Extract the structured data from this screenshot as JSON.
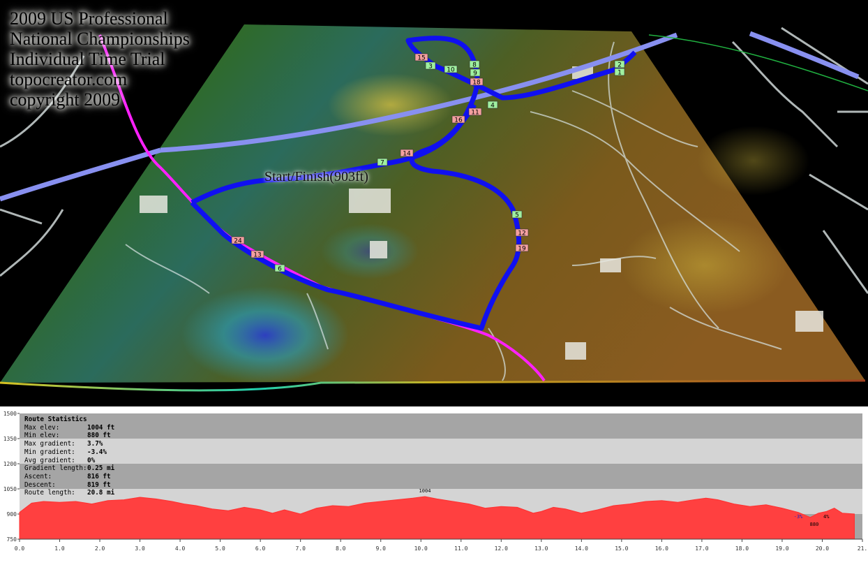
{
  "title_lines": [
    "2009 US Professional",
    "National Championships",
    "Individual Time Trial",
    "topocreator.com",
    "copyright 2009"
  ],
  "start_finish_label": "Start/Finish(903ft)",
  "route_markers": [
    {
      "label": "24",
      "color": "#f4a0a0"
    },
    {
      "label": "13",
      "color": "#f4a0a0"
    },
    {
      "label": "6",
      "color": "#a0f0a0"
    },
    {
      "label": "7",
      "color": "#a0f0a0"
    },
    {
      "label": "14",
      "color": "#f4a0a0"
    },
    {
      "label": "16",
      "color": "#f4a0a0"
    },
    {
      "label": "11",
      "color": "#f4a0a0"
    },
    {
      "label": "4",
      "color": "#a0f0a0"
    },
    {
      "label": "5",
      "color": "#a0f0a0"
    },
    {
      "label": "12",
      "color": "#f4a0a0"
    },
    {
      "label": "19",
      "color": "#f4a0a0"
    },
    {
      "label": "18",
      "color": "#f4a0a0"
    },
    {
      "label": "9",
      "color": "#a0f0a0"
    },
    {
      "label": "8",
      "color": "#a0f0a0"
    },
    {
      "label": "10",
      "color": "#a0f0a0"
    },
    {
      "label": "3",
      "color": "#a0f0a0"
    },
    {
      "label": "15",
      "color": "#f4a0a0"
    },
    {
      "label": "1",
      "color": "#a0f0a0"
    },
    {
      "label": "2",
      "color": "#a0f0a0"
    }
  ],
  "route_statistics": {
    "heading": "Route Statistics",
    "rows": [
      {
        "label": "Max elev:",
        "value": "1004 ft"
      },
      {
        "label": "Min elev:",
        "value": "880 ft"
      },
      {
        "label": "Max gradient:",
        "value": "3.7%"
      },
      {
        "label": "Min gradient:",
        "value": "-3.4%"
      },
      {
        "label": "Avg gradient:",
        "value": "0%"
      },
      {
        "label": "Gradient length:",
        "value": "0.25 mi"
      },
      {
        "label": "Ascent:",
        "value": "816 ft"
      },
      {
        "label": "Descent:",
        "value": "819 ft"
      },
      {
        "label": "Route length:",
        "value": "20.8 mi"
      }
    ]
  },
  "chart_data": {
    "type": "area",
    "xlabel": "",
    "ylabel": "",
    "xlim": [
      0,
      21
    ],
    "ylim": [
      750,
      1500
    ],
    "x_ticks": [
      "0.0",
      "1.0",
      "2.0",
      "3.0",
      "4.0",
      "5.0",
      "6.0",
      "7.0",
      "8.0",
      "9.0",
      "10.0",
      "11.0",
      "12.0",
      "13.0",
      "14.0",
      "15.0",
      "16.0",
      "17.0",
      "18.0",
      "19.0",
      "20.0",
      "21."
    ],
    "y_ticks": [
      "1500",
      "1350",
      "1200",
      "1050",
      "900",
      "750"
    ],
    "series": [
      {
        "x": [
          0,
          0.3,
          0.6,
          1.0,
          1.4,
          1.8,
          2.2,
          2.6,
          3.0,
          3.4,
          3.8,
          4.1,
          4.4,
          4.8,
          5.2,
          5.6,
          6.0,
          6.3,
          6.6,
          7.0,
          7.4,
          7.8,
          8.2,
          8.6,
          9.0,
          9.4,
          9.8,
          10.1,
          10.4,
          10.8,
          11.2,
          11.6,
          12.0,
          12.4,
          12.8,
          13.0,
          13.3,
          13.6,
          14.0,
          14.4,
          14.8,
          15.2,
          15.6,
          16.0,
          16.4,
          16.8,
          17.1,
          17.4,
          17.8,
          18.2,
          18.6,
          19.0,
          19.4,
          19.7,
          19.9,
          20.1,
          20.3,
          20.5,
          20.8
        ],
        "values": [
          910,
          965,
          975,
          970,
          975,
          960,
          980,
          985,
          1000,
          990,
          975,
          960,
          950,
          930,
          920,
          940,
          925,
          905,
          925,
          900,
          935,
          950,
          945,
          965,
          975,
          985,
          995,
          1004,
          990,
          975,
          960,
          935,
          945,
          940,
          905,
          915,
          940,
          930,
          905,
          925,
          950,
          960,
          975,
          980,
          970,
          985,
          995,
          985,
          960,
          945,
          955,
          935,
          910,
          880,
          905,
          915,
          935,
          905,
          900
        ]
      }
    ],
    "annotations": [
      {
        "text": "1004",
        "x": 10.1,
        "y": 1004
      },
      {
        "text": "880",
        "x": 19.8,
        "y": 880
      },
      {
        "text": "-3%",
        "x": 19.4,
        "y": 900
      },
      {
        "text": "4%",
        "x": 20.1,
        "y": 900
      }
    ]
  }
}
